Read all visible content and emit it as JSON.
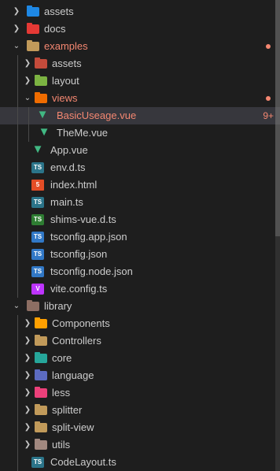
{
  "explorer": {
    "rows": [
      {
        "label": "assets",
        "icon": "folder-icon",
        "icon_color": "#1e88e5",
        "expanded": false
      },
      {
        "label": "docs",
        "icon": "folder-icon",
        "icon_color": "#e53935",
        "expanded": false
      },
      {
        "label": "examples",
        "icon": "folder-icon",
        "icon_color": "#c19a5a",
        "expanded": true,
        "label_color": "#f48771",
        "modified": true
      },
      {
        "label": "assets",
        "icon": "folder-icon",
        "icon_color": "#c44b3b",
        "expanded": false
      },
      {
        "label": "layout",
        "icon": "folder-icon",
        "icon_color": "#7cb342",
        "expanded": false
      },
      {
        "label": "views",
        "icon": "folder-icon",
        "icon_color": "#ef6c00",
        "expanded": true,
        "label_color": "#f48771",
        "modified": true
      },
      {
        "label": "BasicUseage.vue",
        "icon": "vue-icon",
        "icon_color": "#41b883",
        "badge": "9+",
        "active": true
      },
      {
        "label": "TheMe.vue",
        "icon": "vue-icon",
        "icon_color": "#41b883"
      },
      {
        "label": "App.vue",
        "icon": "vue-icon",
        "icon_color": "#41b883"
      },
      {
        "label": "env.d.ts",
        "icon": "typescript-icon",
        "icon_color": "#2b7489",
        "glyph": "TS"
      },
      {
        "label": "index.html",
        "icon": "html-icon",
        "icon_color": "#e44d26",
        "glyph": "5"
      },
      {
        "label": "main.ts",
        "icon": "typescript-icon",
        "icon_color": "#2b7489",
        "glyph": "TS"
      },
      {
        "label": "shims-vue.d.ts",
        "icon": "typescript-icon",
        "icon_color": "#41b883",
        "glyph": "TS"
      },
      {
        "label": "tsconfig.app.json",
        "icon": "tsconfig-icon",
        "icon_color": "#3178c6",
        "glyph": "TS"
      },
      {
        "label": "tsconfig.json",
        "icon": "tsconfig-icon",
        "icon_color": "#3178c6",
        "glyph": "TS"
      },
      {
        "label": "tsconfig.node.json",
        "icon": "tsconfig-icon",
        "icon_color": "#3178c6",
        "glyph": "TS"
      },
      {
        "label": "vite.config.ts",
        "icon": "vite-icon",
        "icon_color": "#bd34fe",
        "glyph": "V"
      },
      {
        "label": "library",
        "icon": "folder-icon",
        "icon_color": "#8d6e63",
        "expanded": true
      },
      {
        "label": "Components",
        "icon": "folder-icon",
        "icon_color": "#ffa000",
        "expanded": false
      },
      {
        "label": "Controllers",
        "icon": "folder-icon",
        "icon_color": "#c19a5a",
        "expanded": false
      },
      {
        "label": "core",
        "icon": "folder-icon",
        "icon_color": "#26a69a",
        "expanded": false
      },
      {
        "label": "language",
        "icon": "folder-icon",
        "icon_color": "#5c6bc0",
        "expanded": false
      },
      {
        "label": "less",
        "icon": "folder-icon",
        "icon_color": "#ec407a",
        "expanded": false
      },
      {
        "label": "splitter",
        "icon": "folder-icon",
        "icon_color": "#c19a5a",
        "expanded": false
      },
      {
        "label": "split-view",
        "icon": "folder-icon",
        "icon_color": "#c19a5a",
        "expanded": false
      },
      {
        "label": "utils",
        "icon": "folder-icon",
        "icon_color": "#a1887f",
        "expanded": false
      },
      {
        "label": "CodeLayout.ts",
        "icon": "typescript-icon",
        "icon_color": "#2b7489",
        "glyph": "TS"
      }
    ]
  },
  "colors": {
    "background": "#1e1e1e",
    "active_row": "#37373d",
    "modified": "#f48771",
    "text": "#cccccc"
  }
}
